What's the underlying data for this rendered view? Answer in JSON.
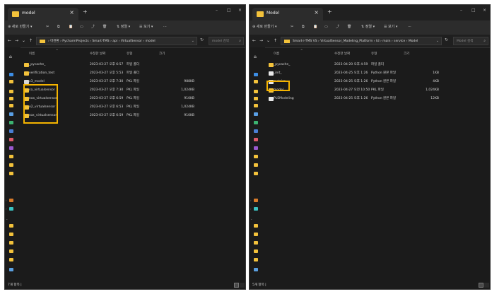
{
  "left": {
    "tab_title": "model",
    "tab_close": "×",
    "new_tab": "+",
    "window_controls": [
      "–",
      "□",
      "×"
    ],
    "toolbar": {
      "new": "⊕ 새로 만들기 ▾",
      "cut": "✂",
      "copy": "⧉",
      "paste": "📋",
      "rename": "▭",
      "share": "⤴",
      "delete": "🗑",
      "sort": "⇅ 정렬 ▾",
      "view": "☰ 보기 ▾",
      "more": "···"
    },
    "nav": {
      "back": "←",
      "forward": "→",
      "recent": "⌄",
      "up": "↑"
    },
    "address_path": "› 마관환 › PycharmProjects › Smart-TMS › api › VirtualSensor › model",
    "address_dropdown": "⌄",
    "refresh": "↻",
    "search_placeholder": "model 검색",
    "search_icon": "⌕",
    "columns": {
      "name": "이름",
      "date": "수정한 날짜",
      "type": "유형",
      "size": "크기"
    },
    "sort_indicator": "^",
    "files": [
      {
        "name": "_pycache_",
        "date": "2023-03-27 오후 6:57",
        "type": "파일 폴더",
        "size": "",
        "icon": "folder-icon"
      },
      {
        "name": "verification_test",
        "date": "2023-03-27 오후 5:53",
        "type": "파일 폴더",
        "size": "",
        "icon": "folder-icon"
      },
      {
        "name": "x3_model",
        "date": "2023-03-27 오후 7:30",
        "type": "PKL 파일",
        "size": "988KB",
        "icon": "file-icon"
      },
      {
        "name": "co_virtualsensor",
        "date": "2023-03-27 오후 7:30",
        "type": "PKL 파일",
        "size": "1,024KB",
        "icon": "pkl-file-icon"
      },
      {
        "name": "nox_virtualsensor",
        "date": "2023-03-27 오후 6:59",
        "type": "PKL 파일",
        "size": "910KB",
        "icon": "pkl-file-icon"
      },
      {
        "name": "o2_virtualsensor",
        "date": "2023-03-27 오후 6:53",
        "type": "PKL 파일",
        "size": "1,024KB",
        "icon": "pkl-file-icon"
      },
      {
        "name": "sox_virtualsensor",
        "date": "2023-03-27 오후 6:59",
        "type": "PKL 파일",
        "size": "910KB",
        "icon": "pkl-file-icon"
      }
    ],
    "status_text": "7개 항목 |"
  },
  "right": {
    "tab_title": "Model",
    "tab_close": "×",
    "new_tab": "+",
    "window_controls": [
      "–",
      "□",
      "×"
    ],
    "toolbar": {
      "new": "⊕ 새로 만들기 ▾",
      "cut": "✂",
      "copy": "⧉",
      "paste": "📋",
      "rename": "▭",
      "share": "⤴",
      "delete": "🗑",
      "sort": "⇅ 정렬 ▾",
      "view": "☰ 보기 ▾",
      "more": "···"
    },
    "nav": {
      "back": "←",
      "forward": "→",
      "recent": "⌄",
      "up": "↑"
    },
    "address_path": "Smart-i-TMS VS › VirtualSensor_Modeling_Platform › td › main › service › Model",
    "address_dropdown": "⌄",
    "refresh": "↻",
    "search_placeholder": "Model 검색",
    "search_icon": "⌕",
    "columns": {
      "name": "이름",
      "date": "수정한 날짜",
      "type": "유형",
      "size": "크기"
    },
    "sort_indicator": "^",
    "files": [
      {
        "name": "_pycache_",
        "date": "2023-04-20 오후 4:59",
        "type": "파일 폴더",
        "size": "",
        "icon": "folder-icon"
      },
      {
        "name": "_init_",
        "date": "2023-04-25 오후 1:26",
        "type": "Python 원본 파일",
        "size": "1KB",
        "icon": "python-file-icon"
      },
      {
        "name": "metrics",
        "date": "2023-04-25 오후 1:26",
        "type": "Python 원본 파일",
        "size": "4KB",
        "icon": "python-file-icon"
      },
      {
        "name": "model",
        "date": "2023-04-27 오전 10:50",
        "type": "PKL 파일",
        "size": "1,024KB",
        "icon": "pkl-file-icon"
      },
      {
        "name": "PLSModeling",
        "date": "2023-04-25 오후 1:26",
        "type": "Python 원본 파일",
        "size": "12KB",
        "icon": "python-file-icon"
      }
    ],
    "status_text": "5개 항목 |"
  },
  "colors": {
    "window_bg": "#1b1b1b",
    "toolbar_bg": "#2c2c2c",
    "folder": "#f3c23b",
    "highlight": "#f5b400",
    "text": "#d6d6d6"
  }
}
